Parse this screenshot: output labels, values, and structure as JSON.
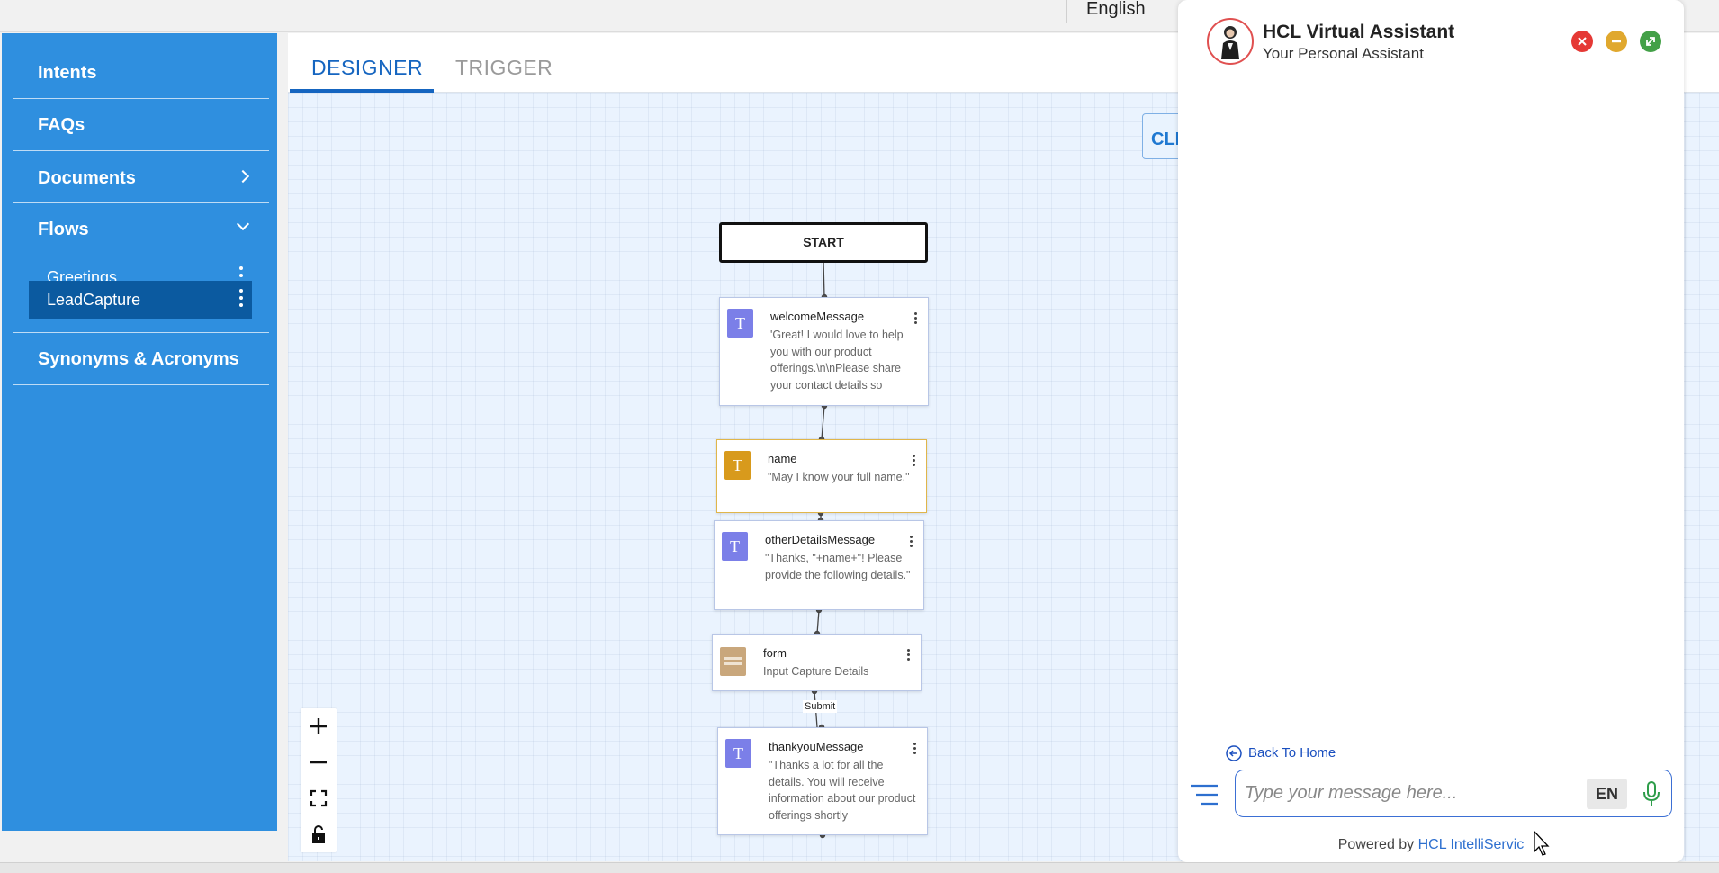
{
  "topbar": {
    "language": "English"
  },
  "sidebar": {
    "items": [
      {
        "label": "Intents"
      },
      {
        "label": "FAQs"
      },
      {
        "label": "Documents"
      },
      {
        "label": "Flows"
      },
      {
        "label": "Synonyms & Acronyms"
      }
    ],
    "flows": [
      {
        "label": "Greetings",
        "active": false
      },
      {
        "label": "LeadCapture",
        "active": true
      }
    ]
  },
  "tabs": [
    {
      "label": "DESIGNER",
      "active": true
    },
    {
      "label": "TRIGGER",
      "active": false
    }
  ],
  "canvas": {
    "clear_label": "CLE",
    "submit_label": "Submit"
  },
  "flow": {
    "start": "START",
    "nodes": [
      {
        "title": "welcomeMessage",
        "body": "'Great! I would love to help you with our product offerings.\\n\\nPlease share your contact details so",
        "icon": "text-icon"
      },
      {
        "title": "name",
        "body": "\"May I know your full name.\"",
        "icon": "text-input-icon"
      },
      {
        "title": "otherDetailsMessage",
        "body": "\"Thanks, \"+name+\"! Please provide the following details.\"",
        "icon": "text-icon"
      },
      {
        "title": "form",
        "body": "Input Capture Details",
        "icon": "form-icon"
      },
      {
        "title": "thankyouMessage",
        "body": "\"Thanks a lot for all the details. You will receive information about our product offerings shortly",
        "icon": "text-icon"
      }
    ]
  },
  "chat": {
    "title": "HCL Virtual Assistant",
    "subtitle": "Your Personal Assistant",
    "back_home": "Back To Home",
    "placeholder": "Type your message here...",
    "lang_button": "EN",
    "powered_prefix": "Powered by ",
    "powered_brand": "HCL IntelliServic"
  },
  "colors": {
    "sidebar": "#2f8fdf",
    "sidebar_active": "#0b5aa0",
    "accent": "#1565c0",
    "node_text": "#7b7fe8",
    "node_input": "#d89a1c"
  }
}
